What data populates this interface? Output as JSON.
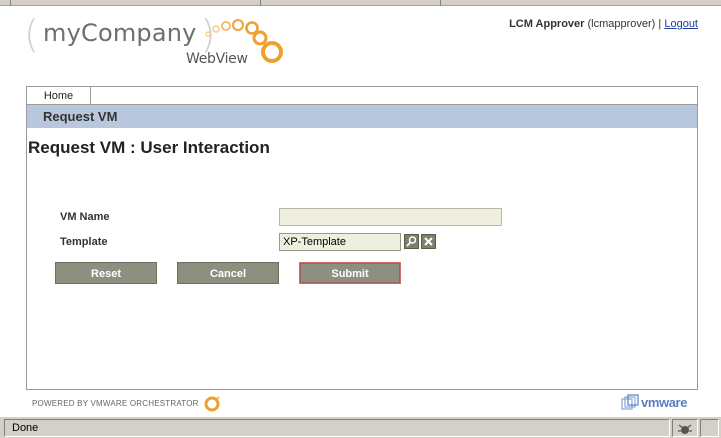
{
  "logo": {
    "brand": "myCompany",
    "product": "WebView",
    "open_paren": "(",
    "close_paren": ")"
  },
  "user": {
    "name": "LCM Approver",
    "username": "(lcmapprover)",
    "separator": "|",
    "logout": "Logout"
  },
  "tabs": [
    {
      "label": "Home"
    }
  ],
  "panel_title": "Request VM",
  "page_heading": "Request VM : User Interaction",
  "form": {
    "vm_name": {
      "label": "VM Name",
      "value": ""
    },
    "template": {
      "label": "Template",
      "value": "XP-Template"
    }
  },
  "buttons": {
    "reset": "Reset",
    "cancel": "Cancel",
    "submit": "Submit"
  },
  "footer": {
    "powered_by": "POWERED BY VMWARE ORCHESTRATOR",
    "vendor": "vmware"
  },
  "status": {
    "text": "Done"
  },
  "colors": {
    "title_bar": "#b8c7dc",
    "button": "#8f8f7f",
    "input_bg": "#efefdf",
    "accent_orange": "#f0a030",
    "link": "#1a3fa6"
  }
}
